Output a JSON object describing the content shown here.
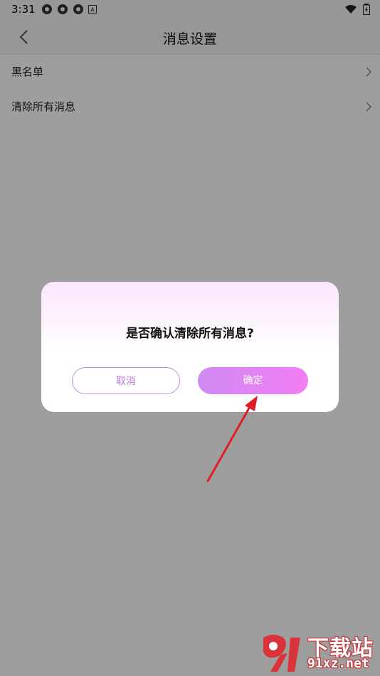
{
  "status_bar": {
    "time": "3:31",
    "left_icons": [
      "hotspot-icon",
      "hotspot-icon",
      "hotspot-icon",
      "keyboard-icon"
    ],
    "right_icons": [
      "wifi-icon",
      "battery-charging-icon"
    ]
  },
  "nav": {
    "title": "消息设置",
    "back_icon": "chevron-left-icon"
  },
  "list": {
    "items": [
      {
        "label": "黑名单"
      },
      {
        "label": "清除所有消息"
      }
    ]
  },
  "dialog": {
    "message": "是否确认清除所有消息?",
    "cancel_label": "取消",
    "confirm_label": "确定"
  },
  "watermark": {
    "brand": "下载站",
    "domain": "91xz.net"
  },
  "colors": {
    "accent_start": "#cf8af4",
    "accent_end": "#f37ef4",
    "annotation_arrow": "#e01e26"
  }
}
